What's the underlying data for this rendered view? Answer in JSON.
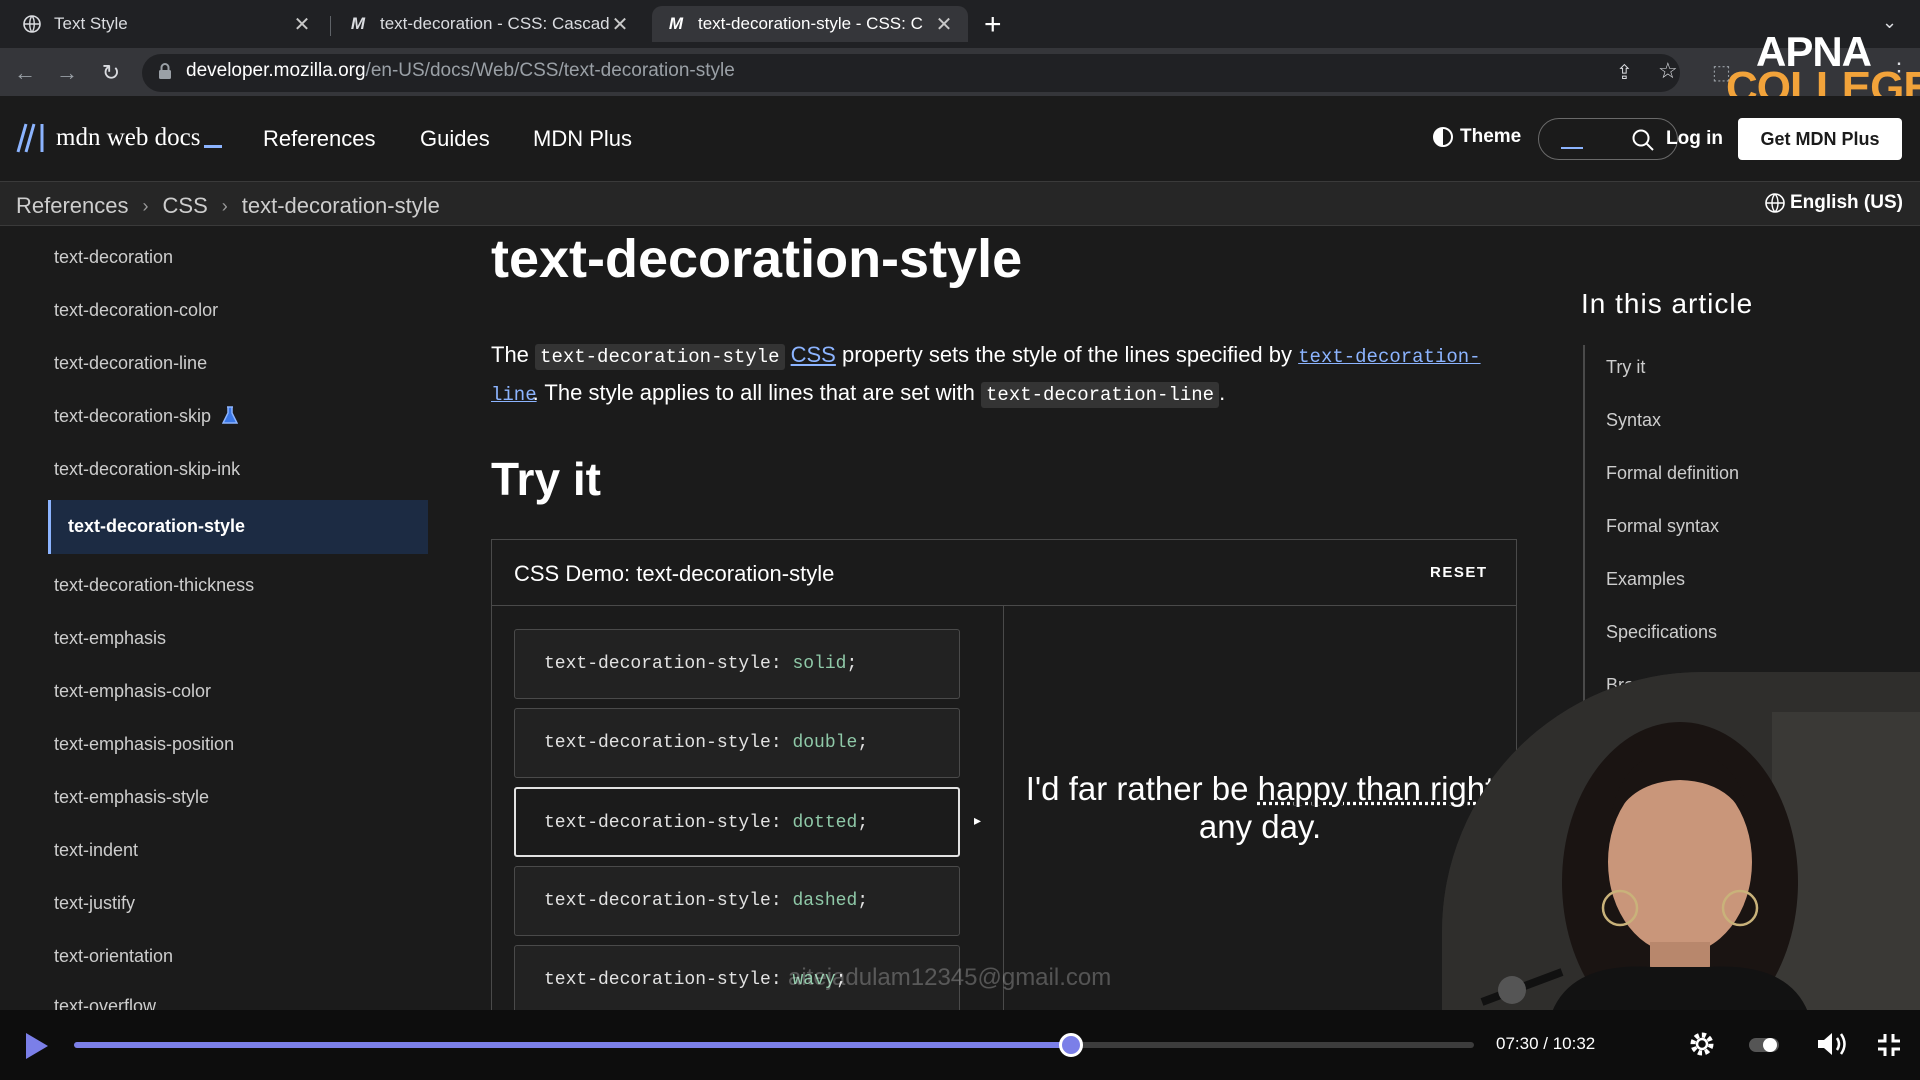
{
  "browser": {
    "tabs": [
      {
        "title": "Text Style"
      },
      {
        "title": "text-decoration - CSS: Cascad"
      },
      {
        "title": "text-decoration-style - CSS: C"
      }
    ],
    "url_domain": "developer.mozilla.org",
    "url_path": "/en-US/docs/Web/CSS/text-decoration-style"
  },
  "header": {
    "logo": "mdn web docs",
    "nav": [
      "References",
      "Guides",
      "MDN Plus"
    ],
    "theme": "Theme",
    "login": "Log in",
    "cta": "Get MDN Plus"
  },
  "breadcrumb": [
    "References",
    "CSS",
    "text-decoration-style"
  ],
  "language": "English (US)",
  "sidebar": {
    "items": [
      "text-decoration",
      "text-decoration-color",
      "text-decoration-line",
      "text-decoration-skip",
      "text-decoration-skip-ink",
      "text-decoration-style",
      "text-decoration-thickness",
      "text-emphasis",
      "text-emphasis-color",
      "text-emphasis-position",
      "text-emphasis-style",
      "text-indent",
      "text-justify",
      "text-orientation",
      "text-overflow"
    ],
    "active": "text-decoration-style"
  },
  "article": {
    "title": "text-decoration-style",
    "intro": {
      "p1": "The",
      "code1": "text-decoration-style",
      "link1": "CSS",
      "p2": "property sets the style of the lines specified by",
      "link2a": "text-decoration-",
      "link2b": "line",
      "p3": ". The style applies to all lines that are set with",
      "code2": "text-decoration-line",
      "p4": "."
    },
    "tryit": "Try it"
  },
  "demo": {
    "title": "CSS Demo: text-decoration-style",
    "reset": "RESET",
    "property": "text-decoration-style:",
    "choices": [
      {
        "value": "solid",
        "suffix": ";"
      },
      {
        "value": "double",
        "suffix": ";"
      },
      {
        "value": "dotted",
        "suffix": ";"
      },
      {
        "value": "dashed",
        "suffix": ";"
      },
      {
        "value": "wavy",
        "suffix": ";"
      }
    ],
    "output_line1_a": "I'd far rather be",
    "output_line1_b": "happy than right",
    "output_line2": "any day."
  },
  "toc": {
    "heading": "In this article",
    "items": [
      "Try it",
      "Syntax",
      "Formal definition",
      "Formal syntax",
      "Examples",
      "Specifications",
      "Brows"
    ]
  },
  "video": {
    "time": "07:30 / 10:32",
    "progress": 0.712,
    "watermark": "aitejadulam12345@gmail.com",
    "logo_top": "APNA",
    "logo_bottom": "COLLEGE"
  }
}
